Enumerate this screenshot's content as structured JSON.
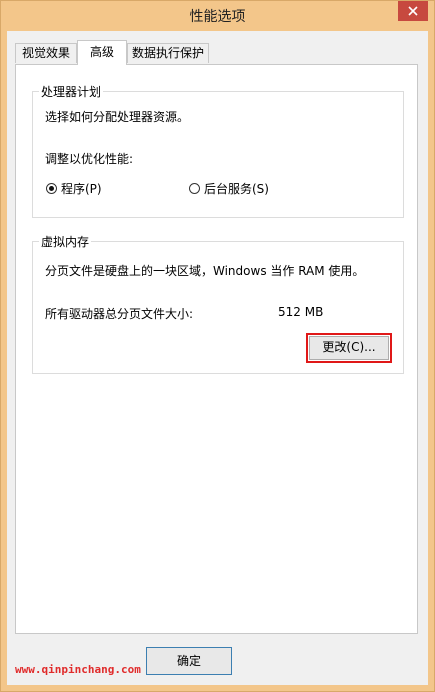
{
  "window": {
    "title": "性能选项"
  },
  "tabs": [
    {
      "label": "视觉效果"
    },
    {
      "label": "高级"
    },
    {
      "label": "数据执行保护"
    }
  ],
  "processor": {
    "group_title": "处理器计划",
    "description": "选择如何分配处理器资源。",
    "adjust_label": "调整以优化性能:",
    "options": [
      {
        "label": "程序(P)",
        "checked": true
      },
      {
        "label": "后台服务(S)",
        "checked": false
      }
    ]
  },
  "virtual_memory": {
    "group_title": "虚拟内存",
    "description": "分页文件是硬盘上的一块区域，Windows 当作 RAM 使用。",
    "total_label": "所有驱动器总分页文件大小:",
    "total_value": "512 MB",
    "change_button": "更改(C)..."
  },
  "footer": {
    "ok_button": "确定"
  },
  "watermark": "www.qinpinchang.com",
  "colors": {
    "frame": "#f3c68a",
    "close": "#c7493f",
    "highlight": "#e01818",
    "watermark": "#e02b2b"
  }
}
